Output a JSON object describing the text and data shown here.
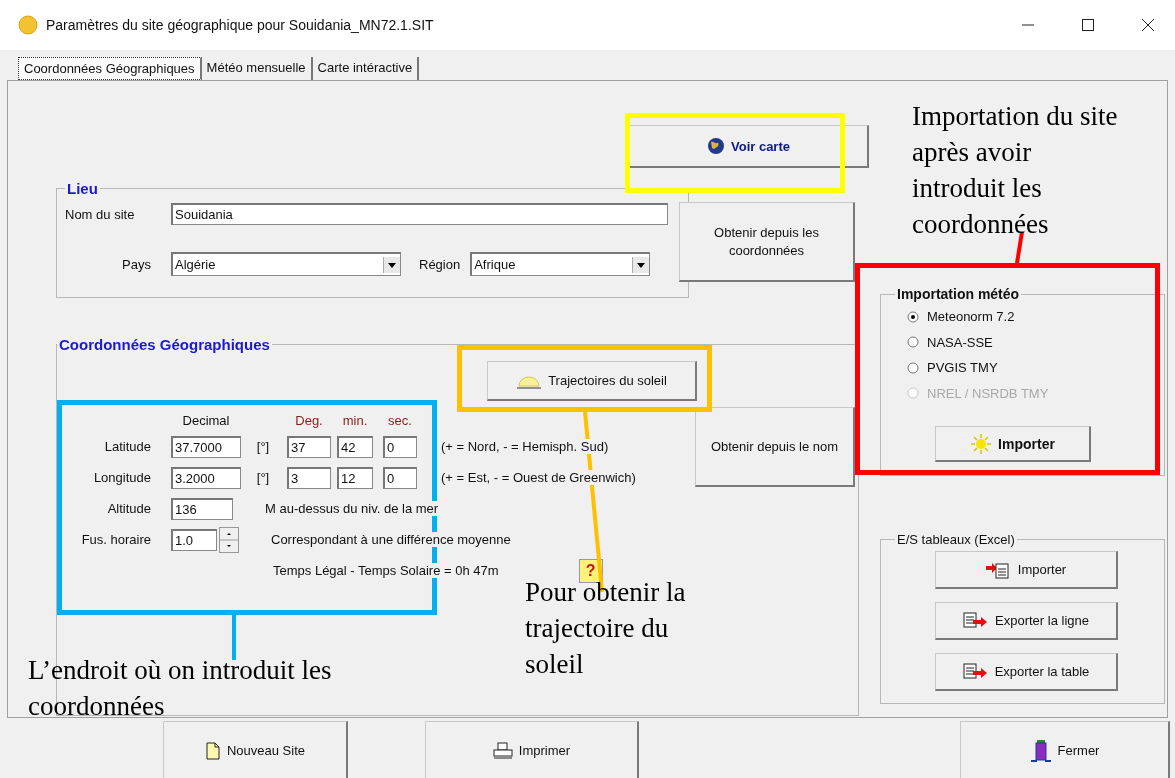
{
  "window": {
    "title": "Paramètres du site géographique pour Souidania_MN72.1.SIT"
  },
  "tabs": [
    {
      "label": "Coordonnées Géographiques",
      "selected": true
    },
    {
      "label": "Météo mensuelle",
      "selected": false
    },
    {
      "label": "Carte intéractive",
      "selected": false
    }
  ],
  "map_button": "Voir carte",
  "place": {
    "title": "Lieu",
    "site_label": "Nom du site",
    "site_value": "Souidania",
    "country_label": "Pays",
    "country_value": "Algérie",
    "region_label": "Région",
    "region_value": "Afrique",
    "from_coords_button": "Obtenir depuis les coordonnées"
  },
  "coordinates": {
    "title": "Coordonnées Géographiques",
    "sun_paths_button": "Trajectoires du soleil",
    "headers": {
      "decimal": "Decimal",
      "deg": "Deg.",
      "min": "min.",
      "sec": "sec."
    },
    "rows": [
      {
        "label": "Latitude",
        "decimal": "37.7000",
        "unit": "[°]",
        "deg": "37",
        "min": "42",
        "sec": "0",
        "hint": "(+ = Nord,  - = Hemisph. Sud)"
      },
      {
        "label": "Longitude",
        "decimal": "3.2000",
        "unit": "[°]",
        "deg": "3",
        "min": "12",
        "sec": "0",
        "hint": "(+ = Est, - = Ouest de Greenwich)"
      }
    ],
    "altitude": {
      "label": "Altitude",
      "value": "136",
      "hint": "M au-dessus du niv. de la mer"
    },
    "timezone": {
      "label": "Fus. horaire",
      "value": "1.0",
      "hint": "Correspondant à une différence moyenne"
    },
    "legal_time": "Temps Légal - Temps Solaire =   0h 47m",
    "help": "?",
    "from_name_button": "Obtenir depuis le nom"
  },
  "weather_import": {
    "title": "Importation météo",
    "options": [
      {
        "label": "Meteonorm 7.2",
        "selected": true,
        "disabled": false
      },
      {
        "label": "NASA-SSE",
        "selected": false,
        "disabled": false
      },
      {
        "label": "PVGIS TMY",
        "selected": false,
        "disabled": false
      },
      {
        "label": "NREL / NSRDB TMY",
        "selected": false,
        "disabled": true
      }
    ],
    "button": "Importer"
  },
  "excel": {
    "title": "E/S tableaux (Excel)",
    "buttons": [
      {
        "label": "Importer",
        "kind": "import"
      },
      {
        "label": "Exporter la ligne",
        "kind": "export"
      },
      {
        "label": "Exporter la table",
        "kind": "export"
      }
    ]
  },
  "footer": [
    {
      "label": "Nouveau Site",
      "kind": "new"
    },
    {
      "label": "Imprimer",
      "kind": "print"
    },
    {
      "label": "Fermer",
      "kind": "close"
    }
  ],
  "annotations": [
    {
      "color": "#ffff00"
    },
    {
      "text": "Pour obtenir la trajectoire du soleil",
      "color": "#ffc000"
    },
    {
      "text": "Importation du site après avoir introduit les coordonnées",
      "color": "#ff0000"
    },
    {
      "text": "L’endroit où on introduit les coordonnées",
      "color": "#00b0f0"
    }
  ]
}
